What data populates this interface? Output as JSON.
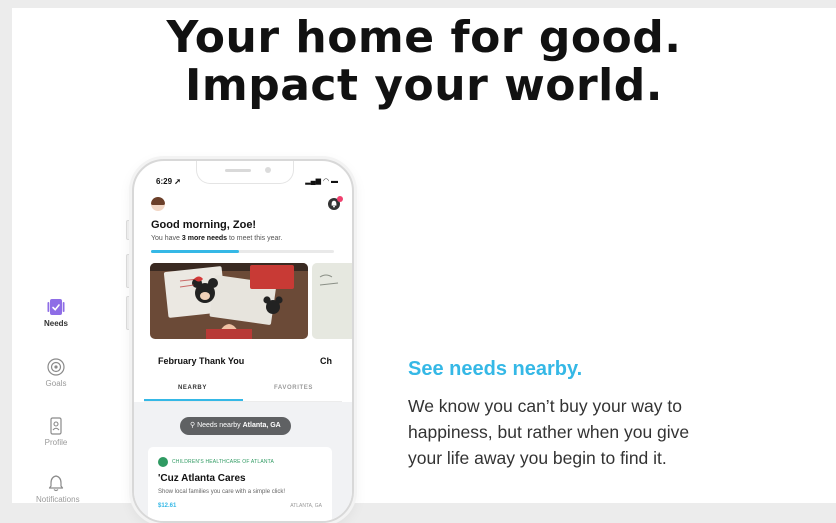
{
  "hero": {
    "line1": "Your home for good.",
    "line2": "Impact your world."
  },
  "rail": {
    "items": [
      {
        "label": "Needs",
        "icon": "needs-icon",
        "active": true
      },
      {
        "label": "Goals",
        "icon": "goals-icon",
        "active": false
      },
      {
        "label": "Profile",
        "icon": "profile-icon",
        "active": false
      },
      {
        "label": "Notifications",
        "icon": "bell-icon",
        "active": false
      }
    ]
  },
  "phone": {
    "time": "6:29",
    "greeting": "Good morning, Zoe!",
    "sub_prefix": "You have ",
    "sub_bold": "3 more needs",
    "sub_suffix": " to meet this year.",
    "progress": 0.48,
    "card_title": "February Thank You",
    "card_peek_title": "Ch",
    "tabs": [
      "NEARBY",
      "FAVORITES"
    ],
    "pill_prefix": "Needs nearby ",
    "pill_location": "Atlanta, GA",
    "need": {
      "org": "CHILDREN'S HEALTHCARE OF ATLANTA",
      "title": "'Cuz Atlanta Cares",
      "description": "Show local families you care with a simple click!",
      "price": "$12.61",
      "location": "ATLANTA, GA"
    }
  },
  "feature": {
    "title": "See needs nearby.",
    "body": [
      "We know you can’t buy your way to",
      "happiness, but rather when you give",
      "your life away you begin to find it."
    ]
  },
  "colors": {
    "accent": "#35b8e6",
    "needs_icon": "#8e6de6",
    "org_green": "#2f9a62",
    "notification_dot": "#f0406e"
  }
}
